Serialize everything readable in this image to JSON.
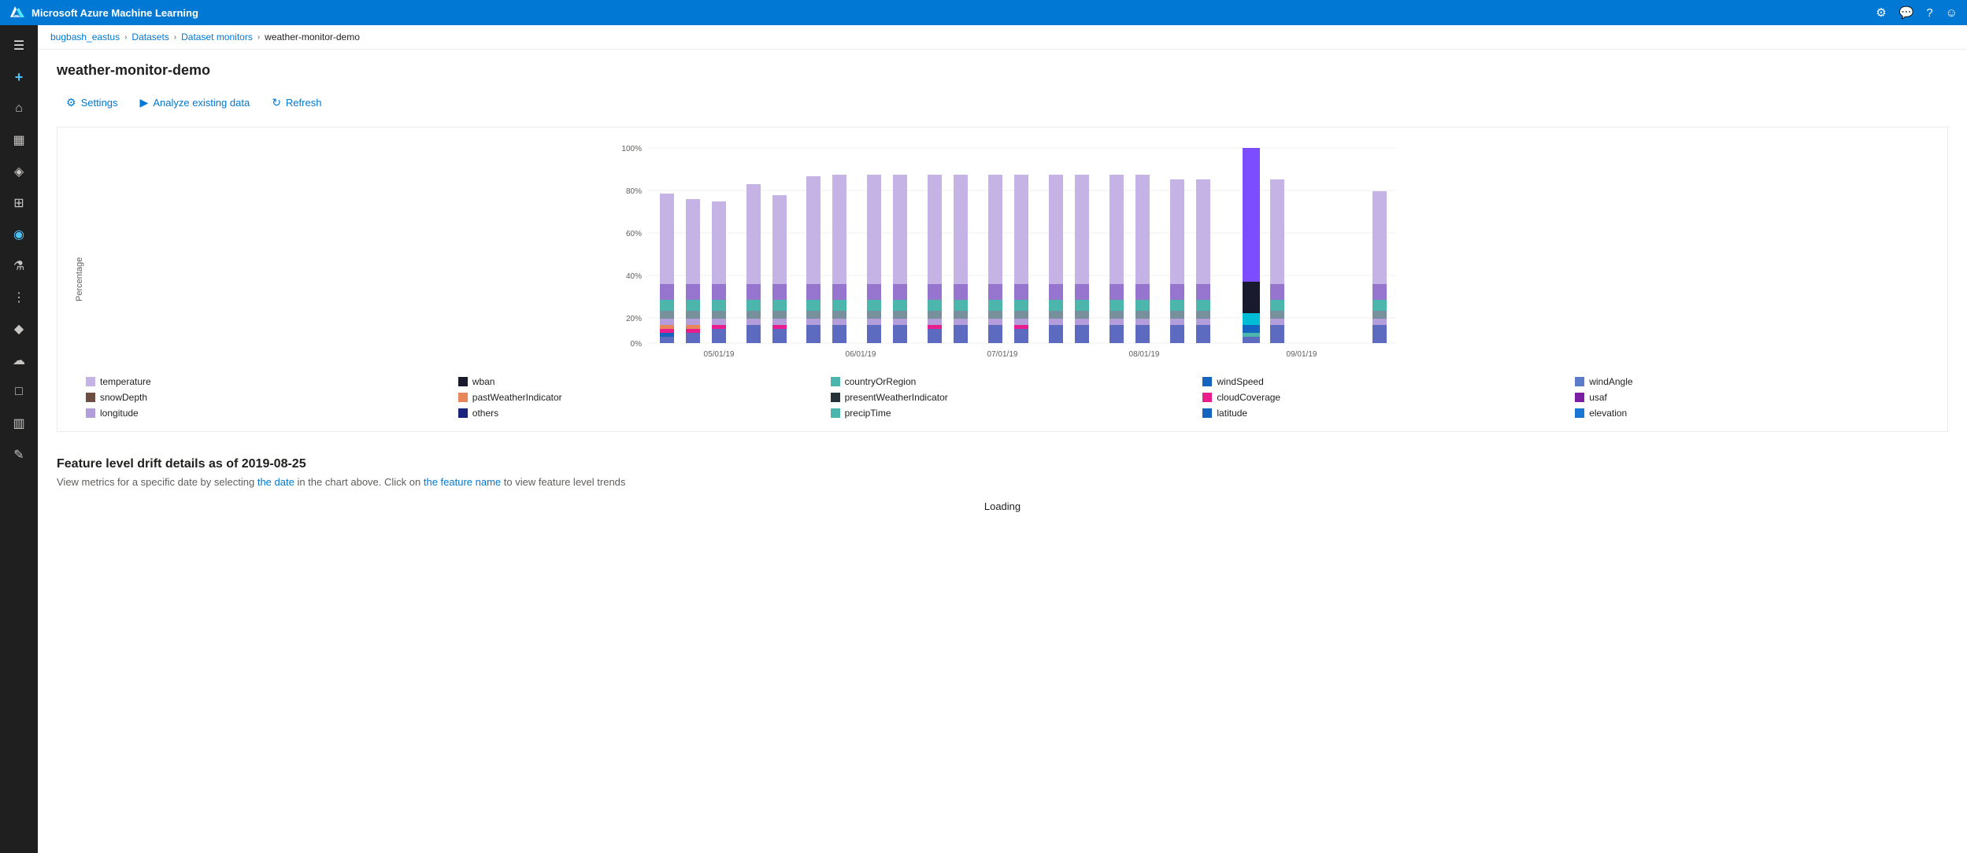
{
  "app": {
    "title": "Microsoft Azure Machine Learning",
    "topbar_icons": [
      "gear",
      "chat",
      "question",
      "user"
    ]
  },
  "breadcrumb": {
    "items": [
      {
        "label": "bugbash_eastus",
        "active": false
      },
      {
        "label": "Datasets",
        "active": false
      },
      {
        "label": "Dataset monitors",
        "active": false
      },
      {
        "label": "weather-monitor-demo",
        "active": true
      }
    ]
  },
  "page": {
    "title": "weather-monitor-demo"
  },
  "toolbar": {
    "settings_label": "Settings",
    "analyze_label": "Analyze existing data",
    "refresh_label": "Refresh"
  },
  "chart": {
    "y_label": "Percentage",
    "y_ticks": [
      "100%",
      "80%",
      "60%",
      "40%",
      "20%",
      "0%"
    ],
    "x_ticks": [
      "05/01/19",
      "06/01/19",
      "07/01/19",
      "08/01/19",
      "09/01/19"
    ]
  },
  "legend": [
    {
      "label": "temperature",
      "color": "#c5b3e6"
    },
    {
      "label": "wban",
      "color": "#1a1a2e"
    },
    {
      "label": "countryOrRegion",
      "color": "#4db6ac"
    },
    {
      "label": "windSpeed",
      "color": "#1565c0"
    },
    {
      "label": "windAngle",
      "color": "#5c7cca"
    },
    {
      "label": "snowDepth",
      "color": "#6d4c41"
    },
    {
      "label": "pastWeatherIndicator",
      "color": "#e8855a"
    },
    {
      "label": "presentWeatherIndicator",
      "color": "#263238"
    },
    {
      "label": "cloudCoverage",
      "color": "#e91e8c"
    },
    {
      "label": "usaf",
      "color": "#7b1fa2"
    },
    {
      "label": "longitude",
      "color": "#b39ddb"
    },
    {
      "label": "others",
      "color": "#1a237e"
    },
    {
      "label": "precipTime",
      "color": "#4db6ac"
    },
    {
      "label": "latitude",
      "color": "#1565c0"
    },
    {
      "label": "elevation",
      "color": "#1976d2"
    }
  ],
  "feature_section": {
    "title": "Feature level drift details as of 2019-08-25",
    "subtitle": "View metrics for a specific date by selecting the date in the chart above. Click on the feature name to view feature level trends",
    "loading": "Loading"
  },
  "sidebar": {
    "icons": [
      {
        "name": "menu-icon",
        "symbol": "☰"
      },
      {
        "name": "plus-icon",
        "symbol": "+"
      },
      {
        "name": "home-icon",
        "symbol": "⌂"
      },
      {
        "name": "dashboard-icon",
        "symbol": "▦"
      },
      {
        "name": "model-icon",
        "symbol": "◈"
      },
      {
        "name": "cluster-icon",
        "symbol": "⊞"
      },
      {
        "name": "dataset-icon",
        "symbol": "◉"
      },
      {
        "name": "experiment-icon",
        "symbol": "⚗"
      },
      {
        "name": "pipeline-icon",
        "symbol": "⋮"
      },
      {
        "name": "deploy-icon",
        "symbol": "◆"
      },
      {
        "name": "cloud-icon",
        "symbol": "☁"
      },
      {
        "name": "monitor-icon",
        "symbol": "◈"
      },
      {
        "name": "compute-icon",
        "symbol": "□"
      },
      {
        "name": "datastore-icon",
        "symbol": "▥"
      },
      {
        "name": "edit-icon",
        "symbol": "✎"
      }
    ]
  }
}
